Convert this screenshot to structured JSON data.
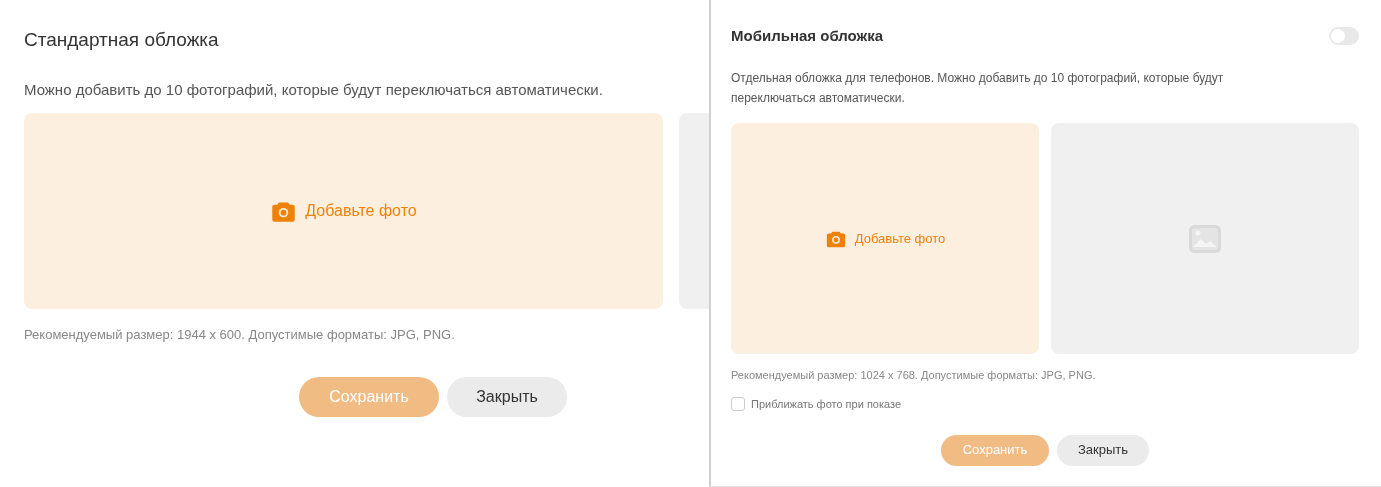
{
  "standard_cover": {
    "title": "Стандартная обложка",
    "description": "Можно добавить до 10 фотографий, которые будут переключаться автоматически.",
    "slots": [
      {
        "kind": "upload",
        "label": "Добавьте фото"
      },
      {
        "kind": "cut_off"
      }
    ],
    "hint": "Рекомендуемый размер: 1944 x 600. Допустимые форматы: JPG, PNG.",
    "buttons": [
      {
        "kind": "primary",
        "label": "Сохранить"
      },
      {
        "kind": "secondary",
        "label": "Закрыть"
      }
    ]
  },
  "mobile_cover": {
    "title": "Мобильная обложка",
    "toggle": {
      "on": false
    },
    "description": "Отдельная обложка для телефонов. Можно добавить до 10 фотографий, которые будут переключаться автоматически.",
    "slots": [
      {
        "kind": "upload",
        "label": "Добавьте фото"
      },
      {
        "kind": "placeholder"
      }
    ],
    "hint": "Рекомендуемый размер: 1024 x 768. Допустимые форматы: JPG, PNG.",
    "checkbox": {
      "label": "Приближать фото при показе",
      "checked": false
    },
    "buttons": [
      {
        "kind": "primary",
        "label": "Сохранить"
      },
      {
        "kind": "secondary",
        "label": "Закрыть"
      }
    ]
  }
}
